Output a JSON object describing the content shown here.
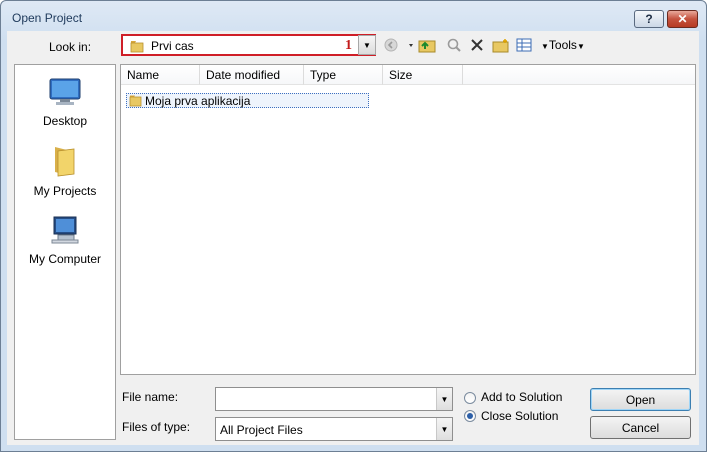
{
  "window": {
    "title": "Open Project",
    "help_label": "?",
    "close_label": "✕"
  },
  "lookin": {
    "label": "Look in:",
    "value": "Prvi cas",
    "annotation": "1"
  },
  "toolbar": {
    "tools_label": "Tools"
  },
  "places": [
    {
      "label": "Desktop",
      "icon": "desktop-icon"
    },
    {
      "label": "My Projects",
      "icon": "folder-icon"
    },
    {
      "label": "My Computer",
      "icon": "computer-icon"
    }
  ],
  "columns": [
    "Name",
    "Date modified",
    "Type",
    "Size"
  ],
  "items": [
    {
      "name": "Moja prva aplikacija",
      "icon": "folder-icon"
    }
  ],
  "filename": {
    "label": "File name:",
    "value": ""
  },
  "filetype": {
    "label": "Files of type:",
    "value": "All Project Files"
  },
  "options": {
    "add_label": "Add to Solution",
    "close_label": "Close Solution",
    "selected": "Close Solution"
  },
  "buttons": {
    "open": "Open",
    "cancel": "Cancel"
  },
  "colors": {
    "highlight_border": "#cf1e27",
    "annotation_text": "#c21a1a",
    "folder": "#e6c35c"
  }
}
